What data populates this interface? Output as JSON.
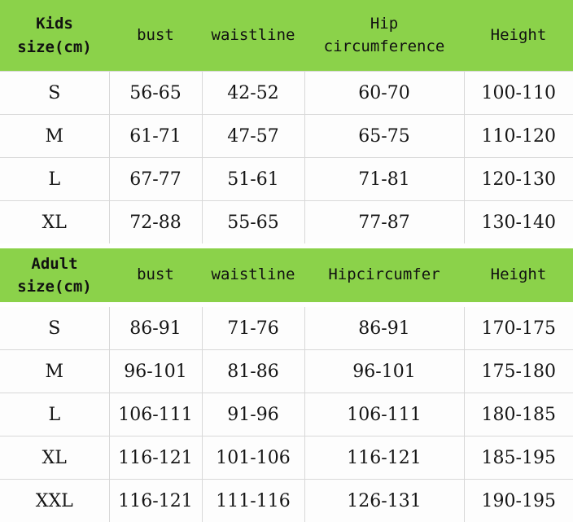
{
  "theme": {
    "header_green": "#8BD24A",
    "grid_line": "#d8d8d8",
    "text_color": "#111111",
    "cell_background": "#fdfdfd"
  },
  "tables": [
    {
      "id": "kids",
      "headers": [
        "Kids\nsize(cm)",
        "bust",
        "waistline",
        "Hip circumference",
        "Height"
      ],
      "header_line1": "Kids",
      "header_line2": "size(cm)",
      "rows": [
        {
          "size": "S",
          "bust": "56-65",
          "waistline": "42-52",
          "hip": "60-70",
          "height": "100-110"
        },
        {
          "size": "M",
          "bust": "61-71",
          "waistline": "47-57",
          "hip": "65-75",
          "height": "110-120"
        },
        {
          "size": "L",
          "bust": "67-77",
          "waistline": "51-61",
          "hip": "71-81",
          "height": "120-130"
        },
        {
          "size": "XL",
          "bust": "72-88",
          "waistline": "55-65",
          "hip": "77-87",
          "height": "130-140"
        }
      ]
    },
    {
      "id": "adult",
      "headers": [
        "Adult\nsize(cm)",
        "bust",
        "waistline",
        "Hipcircumfer",
        "Height"
      ],
      "header_line1": "Adult",
      "header_line2": "size(cm)",
      "rows": [
        {
          "size": "S",
          "bust": "86-91",
          "waistline": "71-76",
          "hip": "86-91",
          "height": "170-175"
        },
        {
          "size": "M",
          "bust": "96-101",
          "waistline": "81-86",
          "hip": "96-101",
          "height": "175-180"
        },
        {
          "size": "L",
          "bust": "106-111",
          "waistline": "91-96",
          "hip": "106-111",
          "height": "180-185"
        },
        {
          "size": "XL",
          "bust": "116-121",
          "waistline": "101-106",
          "hip": "116-121",
          "height": "185-195"
        },
        {
          "size": "XXL",
          "bust": "116-121",
          "waistline": "111-116",
          "hip": "126-131",
          "height": "190-195"
        }
      ]
    }
  ]
}
